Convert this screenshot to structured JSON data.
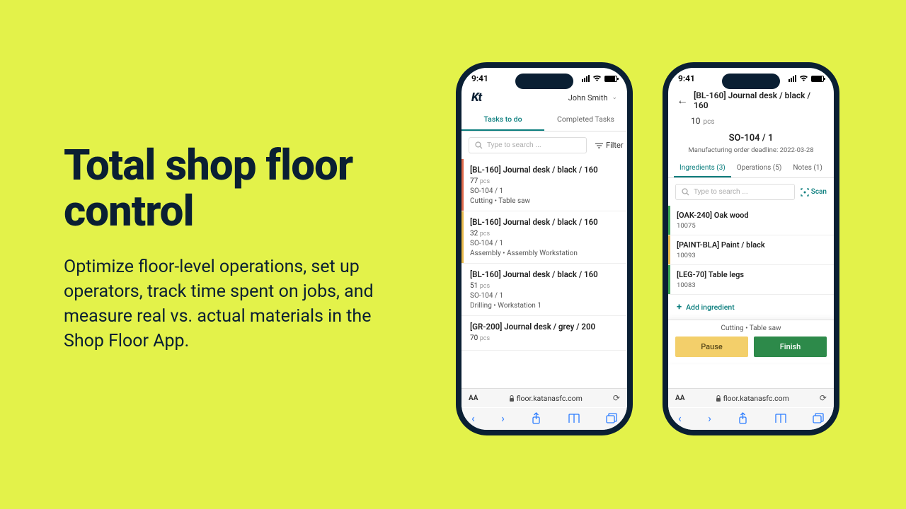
{
  "hero": {
    "title": "Total shop floor control",
    "body": "Optimize floor-level operations, set up operators, track time spent on jobs, and measure real vs. actual materials in the Shop Floor App."
  },
  "status": {
    "time": "9:41"
  },
  "browser": {
    "url": "floor.katanasfc.com",
    "aa": "AA"
  },
  "phone1": {
    "logo": "Kt",
    "user": "John Smith",
    "tabs": {
      "active": "Tasks to do",
      "inactive": "Completed Tasks"
    },
    "search_placeholder": "Type to search ...",
    "filter_label": "Filter",
    "tasks": [
      {
        "title": "[BL-160] Journal desk / black / 160",
        "qty": "77",
        "unit": "pcs",
        "so": "SO-104 / 1",
        "op": "Cutting  •  Table saw",
        "bar": "#e06a4a"
      },
      {
        "title": "[BL-160] Journal desk / black / 160",
        "qty": "32",
        "unit": "pcs",
        "so": "SO-104 / 1",
        "op": "Assembly  •  Assembly Workstation",
        "bar": "#e8b94a"
      },
      {
        "title": "[BL-160] Journal desk / black / 160",
        "qty": "51",
        "unit": "pcs",
        "so": "SO-104 / 1",
        "op": "Drilling  •  Workstation 1",
        "bar": "#ffffff"
      },
      {
        "title": "[GR-200] Journal desk / grey / 200",
        "qty": "70",
        "unit": "pcs",
        "so": "",
        "op": "",
        "bar": "#ffffff",
        "compact": true
      }
    ]
  },
  "phone2": {
    "title": "[BL-160] Journal desk / black / 160",
    "qty": "10",
    "unit": "pcs",
    "so": "SO-104 / 1",
    "deadline": "Manufacturing order deadline: 2022-03-28",
    "tabs": [
      {
        "label": "Ingredients (3)",
        "active": true
      },
      {
        "label": "Operations (5)",
        "active": false
      },
      {
        "label": "Notes (1)",
        "active": false
      }
    ],
    "search_placeholder": "Type to search ...",
    "scan_label": "Scan",
    "ingredients": [
      {
        "name": "[OAK-240] Oak wood",
        "code": "10075",
        "bar": "#3aa655"
      },
      {
        "name": "[PAINT-BLA] Paint / black",
        "code": "10093",
        "bar": "#e8b94a"
      },
      {
        "name": "[LEG-70] Table legs",
        "code": "10083",
        "bar": "#3aa655"
      }
    ],
    "add_label": "Add ingredient",
    "op_label": "Cutting  •  Table saw",
    "pause_label": "Pause",
    "finish_label": "Finish"
  }
}
